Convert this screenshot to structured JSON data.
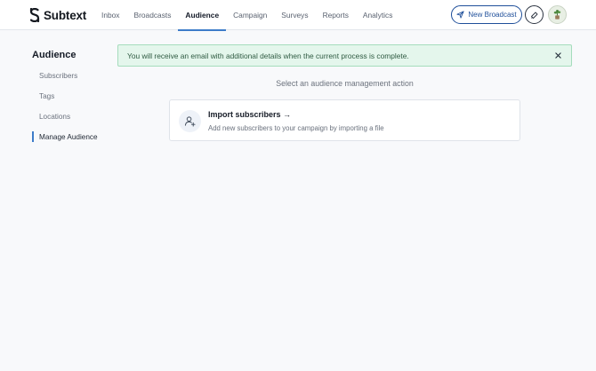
{
  "app": {
    "brand": "Subtext"
  },
  "nav": {
    "items": [
      {
        "label": "Inbox",
        "active": false
      },
      {
        "label": "Broadcasts",
        "active": false
      },
      {
        "label": "Audience",
        "active": true
      },
      {
        "label": "Campaign",
        "active": false
      },
      {
        "label": "Surveys",
        "active": false
      },
      {
        "label": "Reports",
        "active": false
      },
      {
        "label": "Analytics",
        "active": false
      }
    ],
    "new_broadcast_label": "New Broadcast",
    "accent": "#3d7cc9"
  },
  "sidebar": {
    "title": "Audience",
    "items": [
      {
        "label": "Subscribers",
        "active": false
      },
      {
        "label": "Tags",
        "active": false
      },
      {
        "label": "Locations",
        "active": false
      },
      {
        "label": "Manage Audience",
        "active": true
      }
    ]
  },
  "alert": {
    "message": "You will receive an email with additional details when the current process is complete.",
    "icon": "close-icon"
  },
  "main": {
    "hint": "Select an audience management action",
    "actions": [
      {
        "title": "Import subscribers →",
        "description": "Add new subscribers to your campaign by importing a file",
        "icon": "add-user-icon"
      }
    ]
  }
}
